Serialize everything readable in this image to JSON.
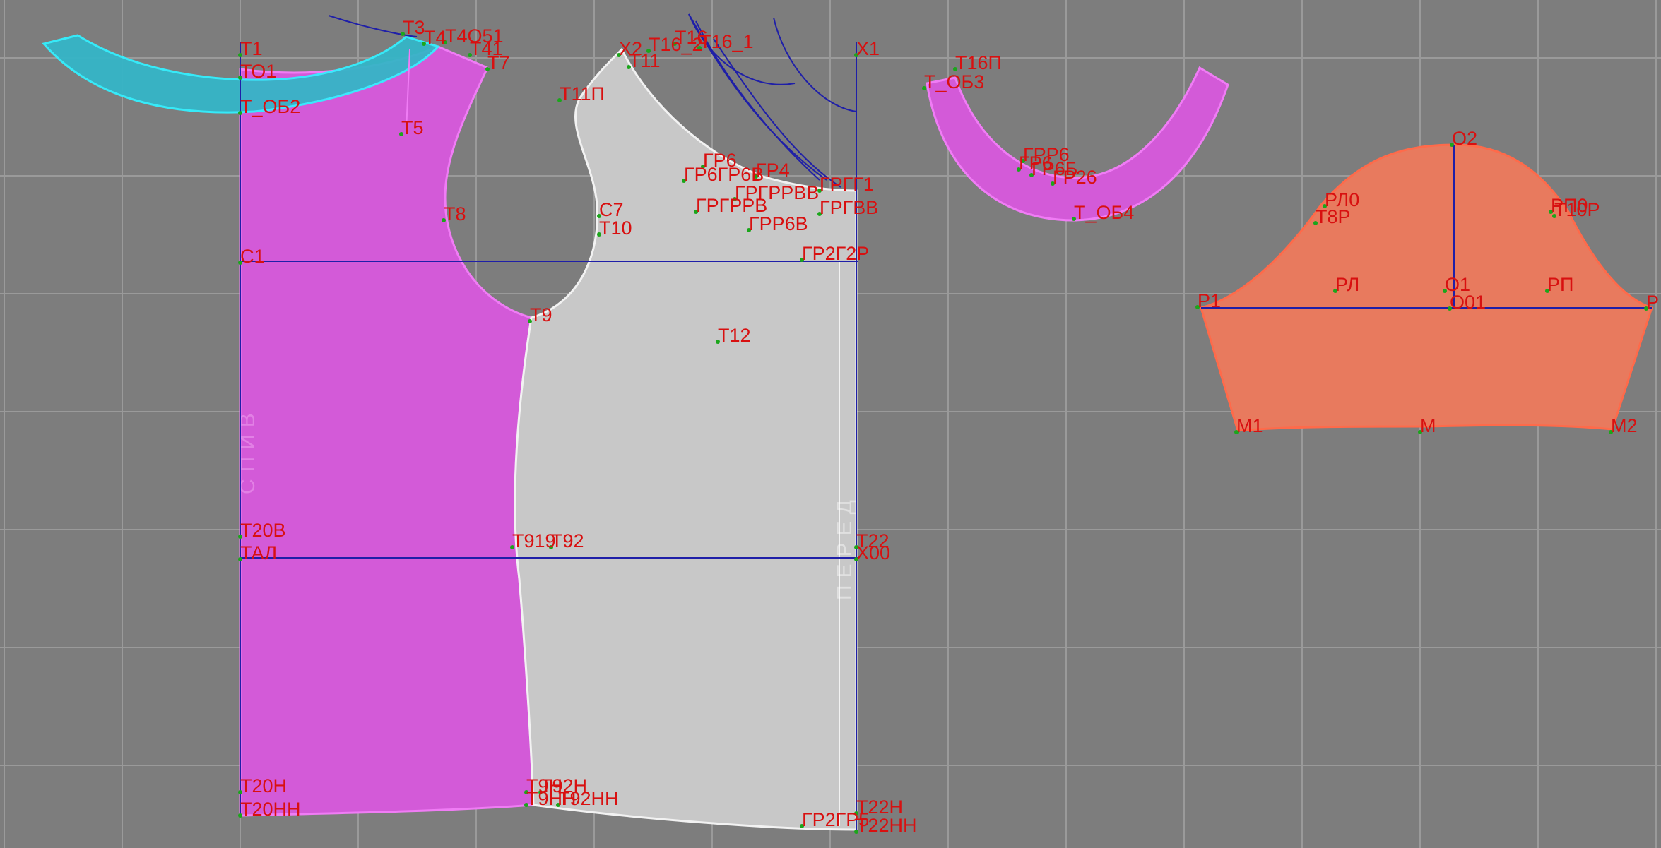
{
  "workspace": {
    "background": "#7d7d7d",
    "grid_color": "#9a9a9a",
    "construction_line_color": "#1f1fa8",
    "label_color": "#d81010"
  },
  "pieces": {
    "back": {
      "color": "#d35ad8",
      "outline": "#f07cf5",
      "watermark": "СПИВ"
    },
    "front": {
      "color": "#c8c8c8",
      "outline": "#f2f2f2",
      "watermark": "ПЕРЕД"
    },
    "collar_band": {
      "color": "#35b5c7",
      "outline": "#33f0ff"
    },
    "neck_facing": {
      "color": "#d35ad8",
      "outline": "#f07cf5"
    },
    "sleeve": {
      "color": "#e87a5e",
      "outline": "#ff6a4a"
    }
  },
  "labels": {
    "back": {
      "t1": "Т1",
      "to1": "ТО1",
      "t_ob2": "Т_ОБ2",
      "t3": "Т3",
      "t4": "Т4",
      "to51": "Т4О51",
      "t41": "Т41",
      "t7": "Т7",
      "t5": "Т5",
      "t8": "Т8",
      "c1": "С1",
      "t9": "Т9",
      "t20v": "Т20В",
      "tal": "ТАЛ",
      "t919": "Т919",
      "t92": "Т92",
      "t20n": "Т20Н",
      "t20nn": "Т20НН"
    },
    "front": {
      "x2": "Х2",
      "t11": "Т11",
      "t16_2": "Т16_2",
      "t16": "Т16",
      "t16_1": "Т16_1",
      "x1": "Х1",
      "t11p": "Т11П",
      "gr6": "ГР6",
      "gr4": "ГР4",
      "grg1": "ГРГГ1",
      "grg_b": "ГРГВВ",
      "grgr_a": "ГР6ГР6В",
      "grgr_b": "ГРГРРВ",
      "grgr_c": "ГРГРРВВ",
      "gr5b": "ГРР6В",
      "c7": "С7",
      "t10": "Т10",
      "gr2p": "ГР2Г2Р",
      "t12": "Т12",
      "t22": "Т22",
      "x00": "Х00",
      "t9n": "Т9Н",
      "t92n": "Т92Н",
      "t9nn": "Т9НН",
      "t92nn": "Т92НН",
      "gr25": "ГР2ГР5",
      "t22n": "Т22Н",
      "t22nn": "Т22НН"
    },
    "facing": {
      "t16p": "Т16П",
      "t_ob3": "Т_ОБ3",
      "gr6": "ГР6",
      "gr6b": "ГР6Б",
      "grr6": "ГРР6",
      "gr26": "ГР26",
      "t_ob4": "Т_ОБ4"
    },
    "sleeve": {
      "o2": "О2",
      "rl0": "РЛ0",
      "t8r": "Т8Р",
      "rp0": "РП0",
      "t10r": "Т10Р",
      "rl": "РЛ",
      "o1": "О1",
      "rp": "РП",
      "p1": "Р1",
      "o01": "О01",
      "p2": "Р",
      "m1": "М1",
      "m": "М",
      "m2": "М2"
    }
  }
}
